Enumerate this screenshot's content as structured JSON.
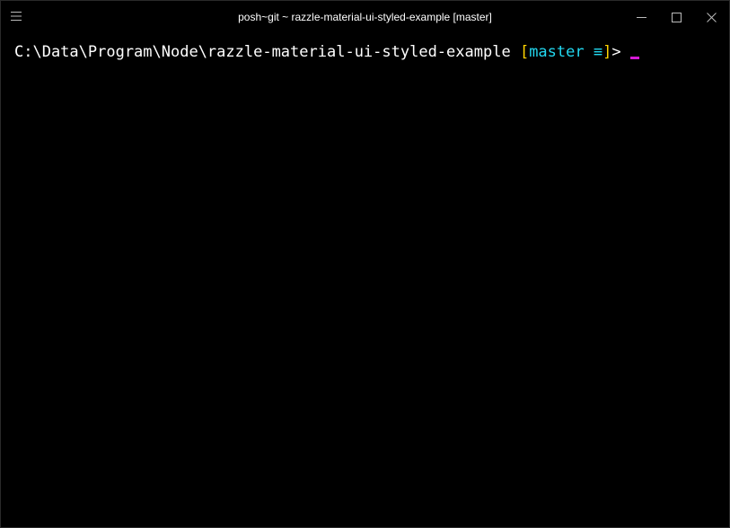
{
  "window": {
    "title": "posh~git ~ razzle-material-ui-styled-example [master]",
    "icons": {
      "menu": "hamburger-icon",
      "minimize": "minimize-icon",
      "maximize": "maximize-icon",
      "close": "close-icon"
    }
  },
  "terminal": {
    "prompt": {
      "path": "C:\\Data\\Program\\Node\\razzle-material-ui-styled-example",
      "bracket_open": "[",
      "branch": "master",
      "status": "≡",
      "bracket_close": "]",
      "arrow": ">"
    }
  },
  "colors": {
    "background": "#000000",
    "text": "#ffffff",
    "bracket": "#ffd400",
    "branch": "#22d8f0",
    "cursor": "#d61ad6"
  }
}
